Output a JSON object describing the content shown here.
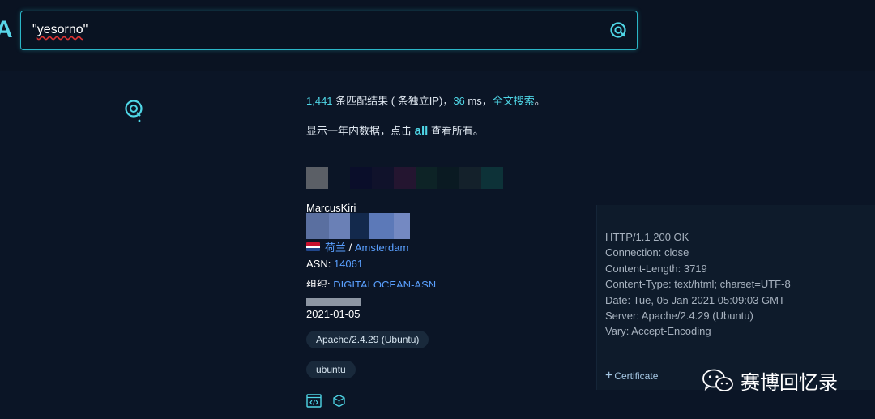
{
  "search": {
    "query_prefix": "\"",
    "query_word": "yesorno",
    "query_suffix": "\""
  },
  "stats": {
    "count": "1,441",
    "matches_label": " 条匹配结果 ( 条独立IP)，",
    "time": "36",
    "time_unit": " ms，",
    "fulltext_link": "全文搜索",
    "period": "。"
  },
  "notice": {
    "before": "显示一年内数据，点击 ",
    "all_link": "all",
    "after": " 查看所有。"
  },
  "result": {
    "hostname": "MarcusKiri",
    "country": "荷兰",
    "separator": " / ",
    "city": "Amsterdam",
    "asn_label": "ASN: ",
    "asn": "14061",
    "org_label": "组织: ",
    "org": "DIGITALOCEAN-ASN",
    "date": "2021-01-05",
    "tags": [
      "Apache/2.4.29 (Ubuntu)",
      "ubuntu"
    ]
  },
  "headers": [
    "HTTP/1.1 200 OK",
    "Connection: close",
    "Content-Length: 3719",
    "Content-Type: text/html; charset=UTF-8",
    "Date: Tue, 05 Jan 2021 05:09:03 GMT",
    "Server: Apache/2.4.29 (Ubuntu)",
    "Vary: Accept-Encoding"
  ],
  "certificate_label": "Certificate",
  "watermark": "赛博回忆录",
  "icons": {
    "search": "search-icon",
    "logo": "logo-icon",
    "code": "code-icon",
    "cube": "cube-icon",
    "wechat": "wechat-icon"
  },
  "colors": {
    "background": "#0b1526",
    "accent": "#4fd6e6",
    "link": "#5aa0ff",
    "panel": "#0e1b2b"
  },
  "mosaic_colors": [
    "#5b5f66",
    "#0b1526",
    "#0a0e2a",
    "#10122b",
    "#241530",
    "#0d2326",
    "#0a1a22",
    "#14212b",
    "#0d3238",
    "#0b1526"
  ],
  "blur_colors": [
    "#5a6fa0",
    "#6a80b6",
    "#13294c",
    "#5c79b8",
    "#7489c2"
  ]
}
